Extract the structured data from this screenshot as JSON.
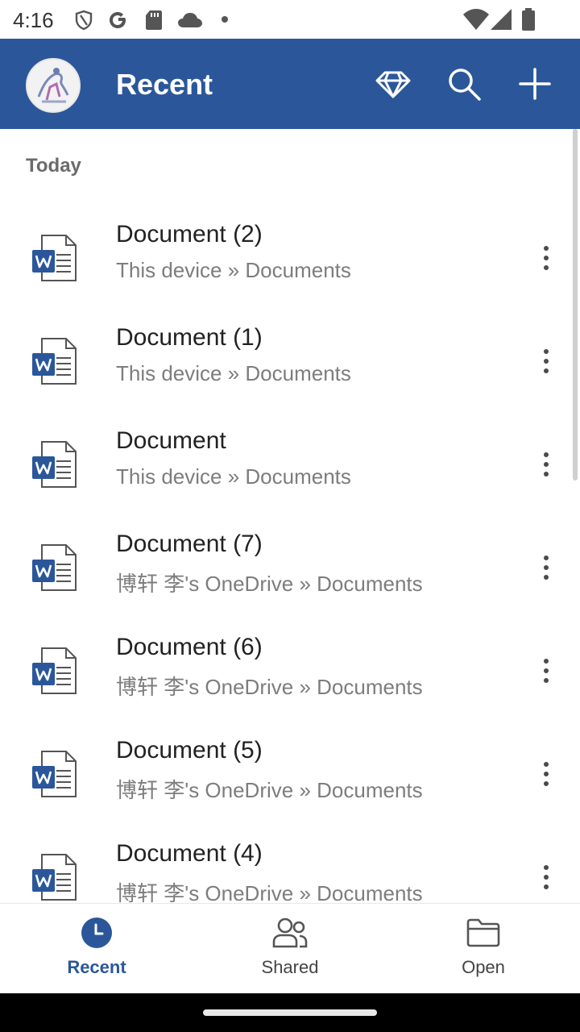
{
  "status_bar": {
    "time": "4:16"
  },
  "app_bar": {
    "title": "Recent"
  },
  "section_header": "Today",
  "documents": [
    {
      "name": "Document (2)",
      "location": "This device » Documents"
    },
    {
      "name": "Document (1)",
      "location": "This device » Documents"
    },
    {
      "name": "Document",
      "location": "This device » Documents"
    },
    {
      "name": "Document (7)",
      "location": "博轩 李's OneDrive » Documents"
    },
    {
      "name": "Document (6)",
      "location": "博轩 李's OneDrive » Documents"
    },
    {
      "name": "Document (5)",
      "location": "博轩 李's OneDrive » Documents"
    },
    {
      "name": "Document (4)",
      "location": "博轩 李's OneDrive » Documents"
    }
  ],
  "bottom_nav": {
    "recent": "Recent",
    "shared": "Shared",
    "open": "Open"
  },
  "colors": {
    "brand": "#2b579a",
    "word_blue": "#2b579a"
  },
  "icons": [
    "shield-icon",
    "google-icon",
    "sd-card-icon",
    "cloud-icon",
    "wifi-icon",
    "signal-icon",
    "battery-icon",
    "premium-diamond-icon",
    "search-icon",
    "plus-icon",
    "word-document-icon",
    "more-vert-icon",
    "clock-icon",
    "people-icon",
    "folder-icon"
  ]
}
